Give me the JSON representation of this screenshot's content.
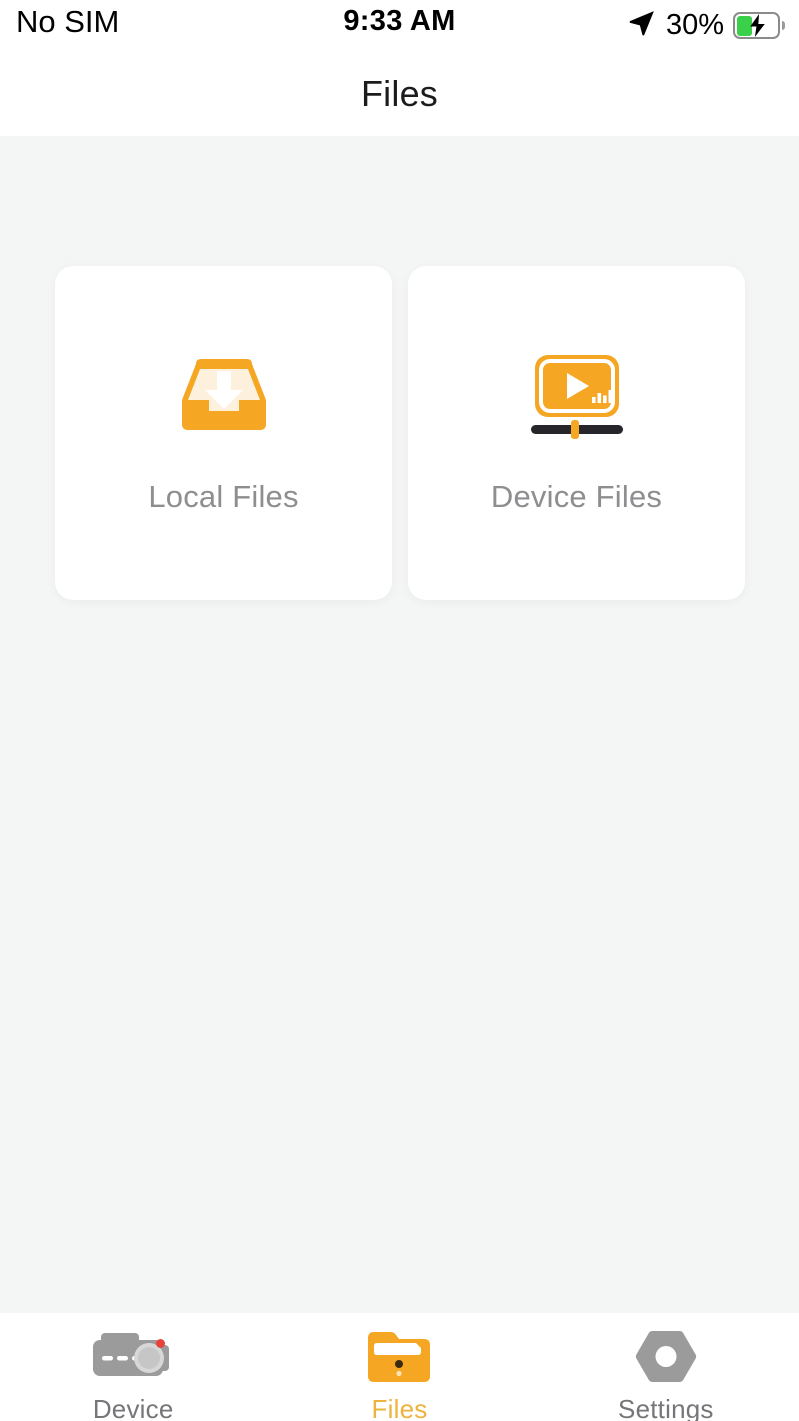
{
  "status_bar": {
    "carrier": "No SIM",
    "time": "9:33 AM",
    "battery_percent": "30%",
    "location_icon": "location-arrow-icon",
    "battery_icon": "battery-charging-icon",
    "battery_fill_color": "#3ad04a",
    "charging": true
  },
  "header": {
    "title": "Files"
  },
  "main": {
    "background_color": "#f4f5f5",
    "cards": [
      {
        "label": "Local Files",
        "icon": "inbox-download-icon",
        "icon_color": "#f5a623"
      },
      {
        "label": "Device Files",
        "icon": "video-player-icon",
        "icon_color": "#f5a623"
      }
    ]
  },
  "tab_bar": {
    "active_color": "#eeb33f",
    "inactive_color": "#76767a",
    "tabs": [
      {
        "label": "Device",
        "icon": "dashcam-icon",
        "active": false
      },
      {
        "label": "Files",
        "icon": "folder-icon",
        "active": true
      },
      {
        "label": "Settings",
        "icon": "hex-nut-icon",
        "active": false
      }
    ]
  }
}
